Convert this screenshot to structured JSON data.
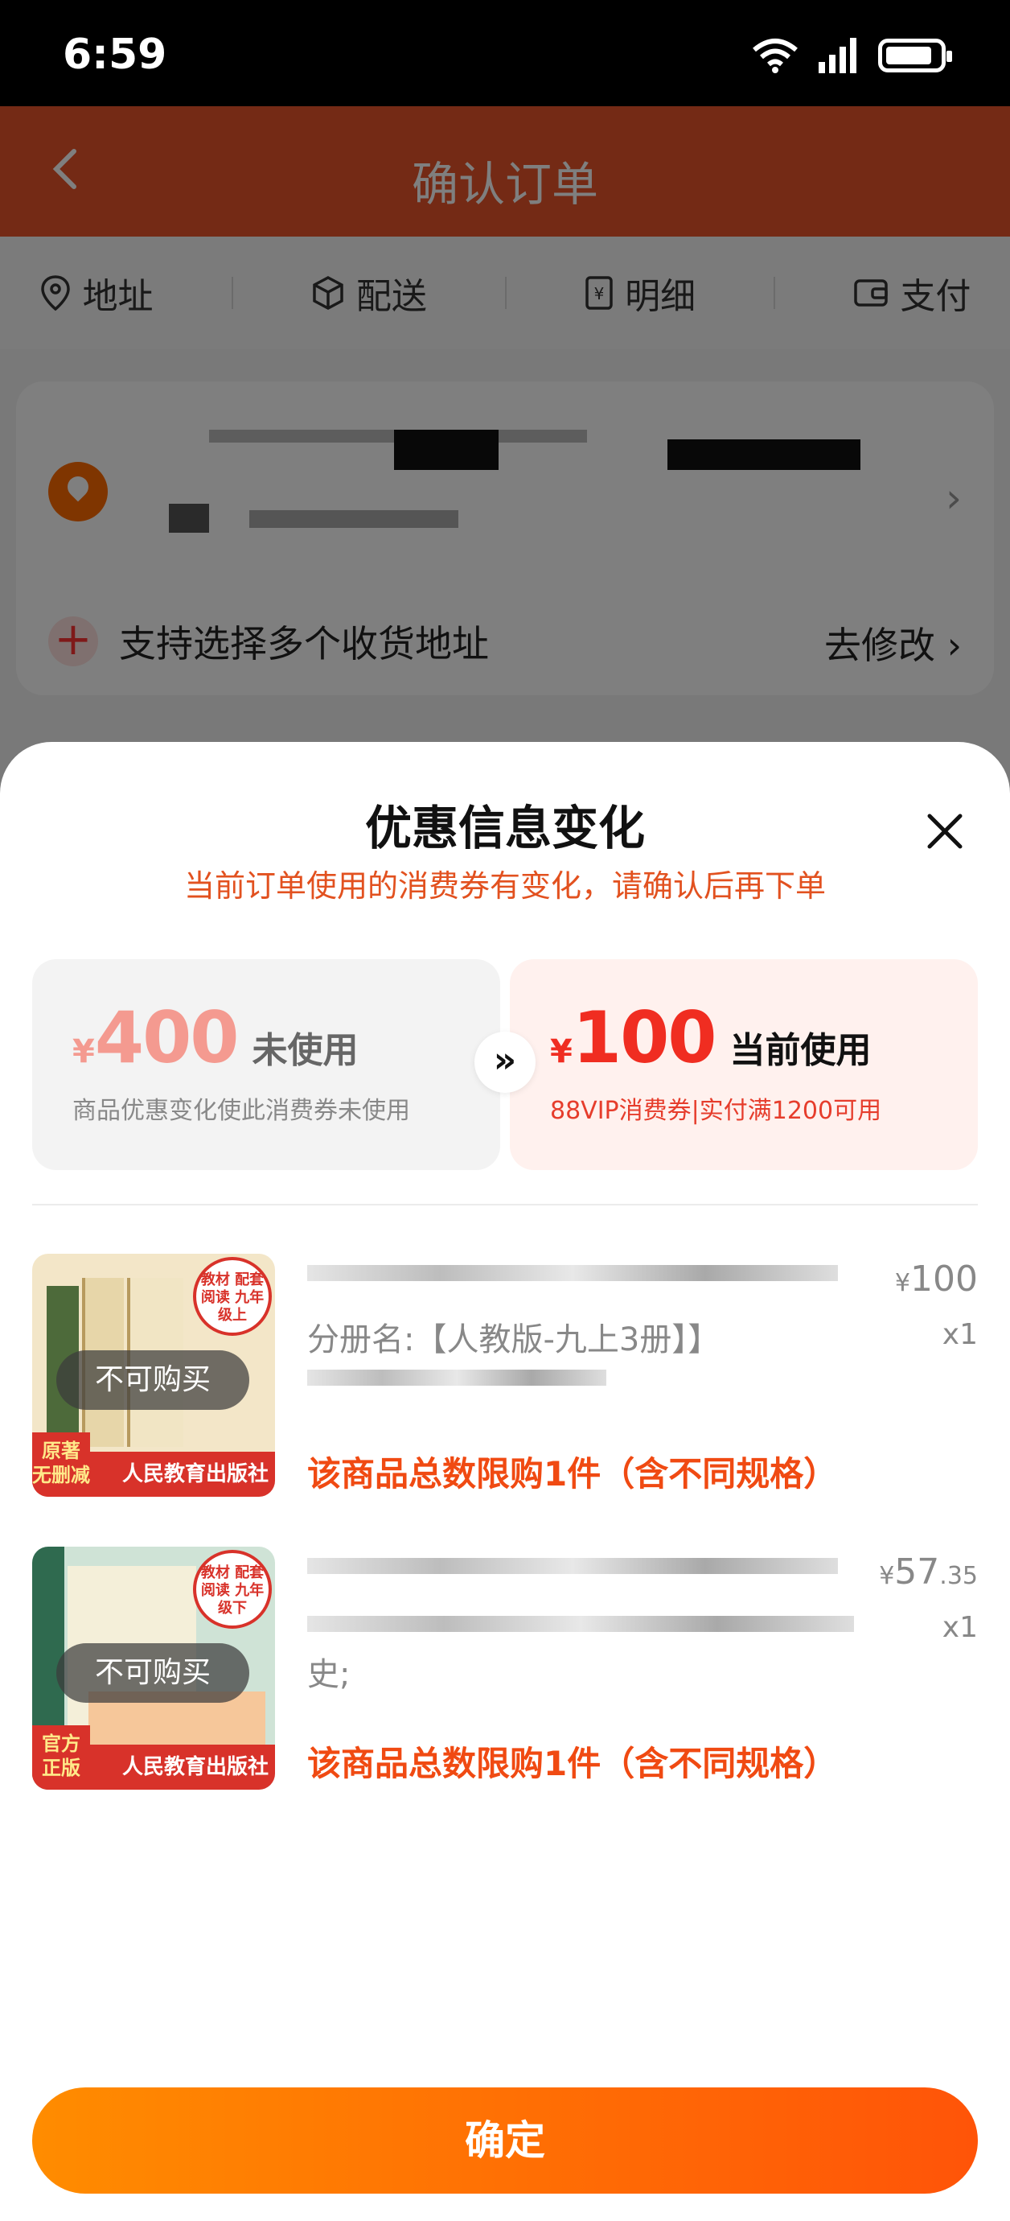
{
  "status_bar": {
    "time": "6:59"
  },
  "nav": {
    "title": "确认订单"
  },
  "steps": [
    {
      "label": "地址",
      "icon": "location-pin-icon"
    },
    {
      "label": "配送",
      "icon": "box-icon"
    },
    {
      "label": "明细",
      "icon": "receipt-icon"
    },
    {
      "label": "支付",
      "icon": "wallet-icon"
    }
  ],
  "address": {
    "multi_label": "支持选择多个收货地址",
    "modify_label": "去修改"
  },
  "sheet": {
    "title": "优惠信息变化",
    "subtitle": "当前订单使用的消费券有变化，请确认后再下单",
    "old_coupon": {
      "currency": "¥",
      "amount": "400",
      "status": "未使用",
      "desc": "商品优惠变化使此消费券未使用"
    },
    "new_coupon": {
      "currency": "¥",
      "amount": "100",
      "status": "当前使用",
      "desc": "88VIP消费券|实付满1200可用"
    },
    "arrow": "»",
    "items": [
      {
        "spec": "分册名:【人教版-九上3册】】",
        "limit": "该商品总数限购1件（含不同规格）",
        "currency": "¥",
        "price_int": "100",
        "price_dec": "",
        "qty": "x1",
        "unavailable": "不可购买",
        "cover_tag": "教材 配套阅读 九年级上",
        "cover_footer": "人民教育出版社",
        "cover_corner": "原著 无删减"
      },
      {
        "spec": "史;",
        "limit": "该商品总数限购1件（含不同规格）",
        "currency": "¥",
        "price_int": "57",
        "price_dec": ".35",
        "qty": "x1",
        "unavailable": "不可购买",
        "cover_tag": "教材 配套阅读 九年级下",
        "cover_footer": "人民教育出版社",
        "cover_corner": "官方 正版"
      }
    ],
    "confirm_label": "确定"
  },
  "colors": {
    "brand_orange": "#ff5408",
    "coupon_red": "#f02d21",
    "limit_text": "#f04a12"
  }
}
